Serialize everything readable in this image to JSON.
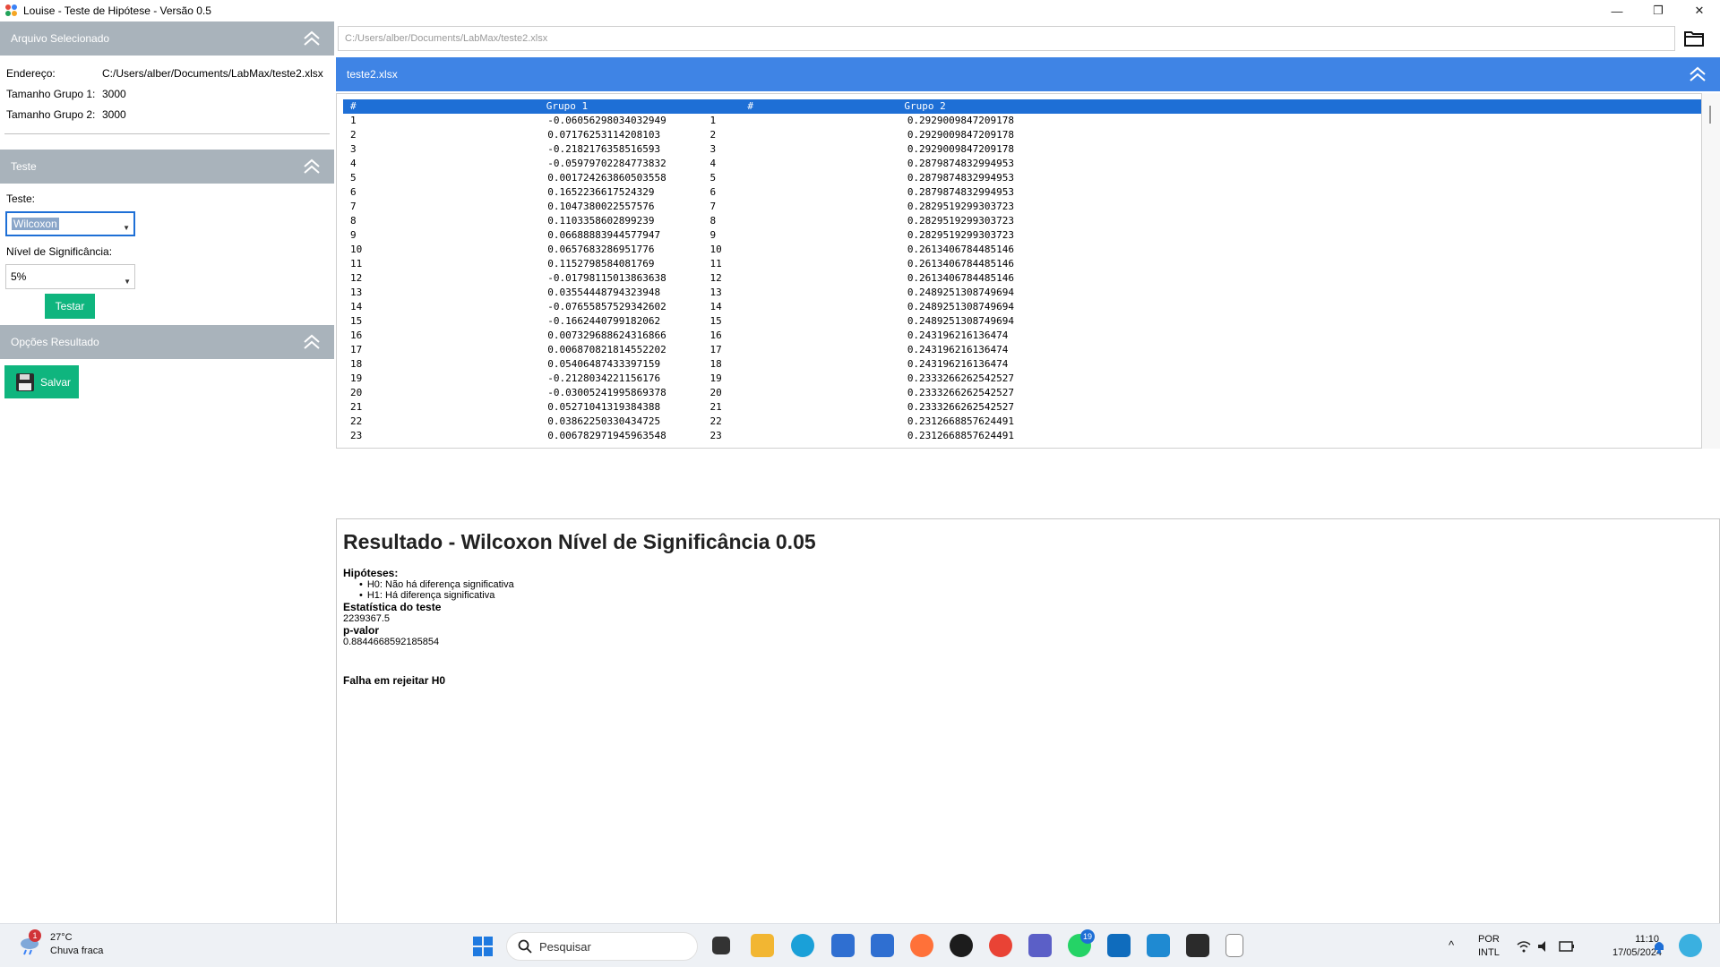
{
  "window": {
    "title": "Louise - Teste de Hipótese - Versão 0.5",
    "controls": [
      "—",
      "❐",
      "✕"
    ]
  },
  "left_panel": {
    "file_section": {
      "header": "Arquivo Selecionado",
      "rows": [
        {
          "label": "Endereço:",
          "value": "C:/Users/alber/Documents/LabMax/teste2.xlsx"
        },
        {
          "label": "Tamanho Grupo 1:",
          "value": "3000"
        },
        {
          "label": "Tamanho Grupo 2:",
          "value": "3000"
        }
      ]
    },
    "test_section": {
      "header": "Teste",
      "test_label": "Teste:",
      "test_value": "Wilcoxon",
      "significance_label": "Nível de Significância:",
      "significance_value": "5%",
      "run_button": "Testar"
    },
    "result_options": {
      "header": "Opções Resultado",
      "save_button": "Salvar"
    }
  },
  "path_input": {
    "value": "C:/Users/alber/Documents/LabMax/teste2.xlsx"
  },
  "file_panel": {
    "header": "teste2.xlsx",
    "table": {
      "columns": [
        "#",
        "Grupo 1",
        "#",
        "Grupo 2"
      ],
      "rows": [
        [
          "1",
          "-0.06056298034032949",
          "1",
          "0.2929009847209178"
        ],
        [
          "2",
          "0.07176253114208103",
          "2",
          "0.2929009847209178"
        ],
        [
          "3",
          "-0.2182176358516593",
          "3",
          "0.2929009847209178"
        ],
        [
          "4",
          "-0.05979702284773832",
          "4",
          "0.2879874832994953"
        ],
        [
          "5",
          "0.001724263860503558",
          "5",
          "0.2879874832994953"
        ],
        [
          "6",
          "0.1652236617524329",
          "6",
          "0.2879874832994953"
        ],
        [
          "7",
          "0.1047380022557576",
          "7",
          "0.2829519299303723"
        ],
        [
          "8",
          "0.1103358602899239",
          "8",
          "0.2829519299303723"
        ],
        [
          "9",
          "0.06688883944577947",
          "9",
          "0.2829519299303723"
        ],
        [
          "10",
          "0.0657683286951776",
          "10",
          "0.2613406784485146"
        ],
        [
          "11",
          "0.1152798584081769",
          "11",
          "0.2613406784485146"
        ],
        [
          "12",
          "-0.01798115013863638",
          "12",
          "0.2613406784485146"
        ],
        [
          "13",
          "0.03554448794323948",
          "13",
          "0.2489251308749694"
        ],
        [
          "14",
          "-0.07655857529342602",
          "14",
          "0.2489251308749694"
        ],
        [
          "15",
          "-0.1662440799182062",
          "15",
          "0.2489251308749694"
        ],
        [
          "16",
          "0.007329688624316866",
          "16",
          "0.243196216136474"
        ],
        [
          "17",
          "0.006870821814552202",
          "17",
          "0.243196216136474"
        ],
        [
          "18",
          "0.05406487433397159",
          "18",
          "0.243196216136474"
        ],
        [
          "19",
          "-0.2128034221156176",
          "19",
          "0.2333266262542527"
        ],
        [
          "20",
          "-0.03005241995869378",
          "20",
          "0.2333266262542527"
        ],
        [
          "21",
          "0.05271041319384388",
          "21",
          "0.2333266262542527"
        ],
        [
          "22",
          "0.03862250330434725",
          "22",
          "0.2312668857624491"
        ],
        [
          "23",
          "0.006782971945963548",
          "23",
          "0.2312668857624491"
        ]
      ]
    }
  },
  "result": {
    "title": "Resultado - Wilcoxon Nível de Significância 0.05",
    "hypotheses_label": "Hipóteses:",
    "h0": "H0: Não há diferença significativa",
    "h1": "H1: Há diferença significativa",
    "statistic_label": "Estatística do teste",
    "statistic_value": "2239367.5",
    "pvalue_label": "p-valor",
    "pvalue_value": "0.8844668592185854",
    "conclusion": "Falha em rejeitar H0"
  },
  "taskbar": {
    "weather_temp": "27°C",
    "weather_desc": "Chuva fraca",
    "weather_badge": "1",
    "search_placeholder": "Pesquisar",
    "whatsapp_badge": "19",
    "language_top": "POR",
    "language_bottom": "INTL",
    "time": "11:10",
    "date": "17/05/2024"
  },
  "colors": {
    "accent_blue": "#3f84e5",
    "selected_blue": "#1e6fd6",
    "section_gray": "#a9b3bb",
    "button_green": "#0fb57e"
  }
}
